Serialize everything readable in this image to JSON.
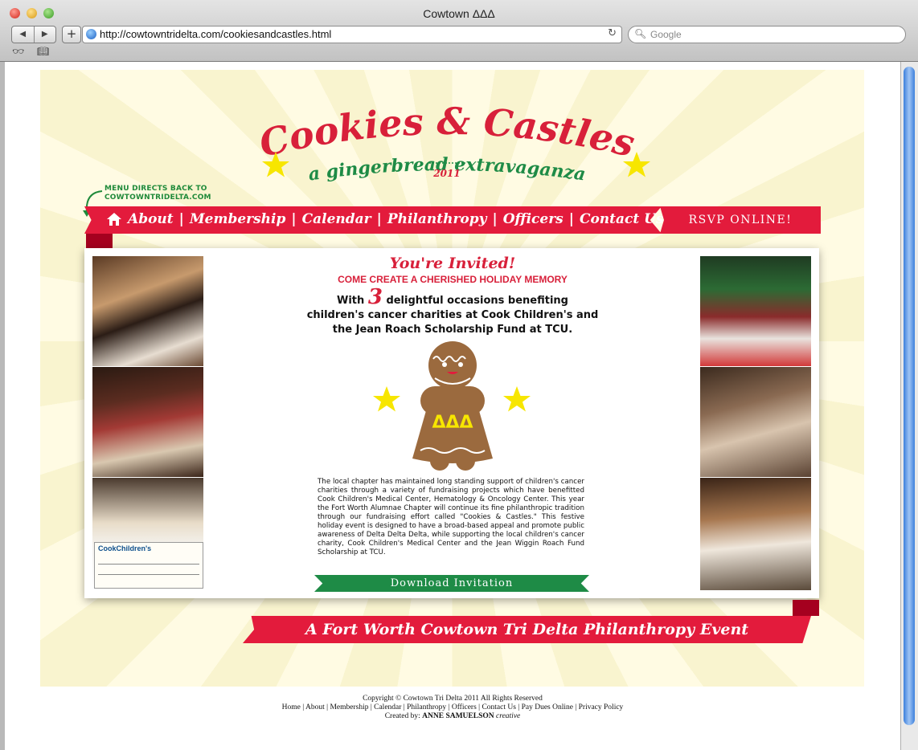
{
  "browser": {
    "window_title": "Cowtown ΔΔΔ",
    "url": "http://cowtowntridelta.com/cookiesandcastles.html",
    "search_placeholder": "Google"
  },
  "header": {
    "menu_note_line1": "MENU DIRECTS BACK TO",
    "menu_note_line2": "COWTOWNTRIDELTA.COM",
    "logo_line1": "Cookies & Castles",
    "logo_line2": "a gingerbread extravaganza",
    "logo_year": "2011"
  },
  "nav": {
    "items": [
      "About",
      "Membership",
      "Calendar",
      "Philanthropy",
      "Officers",
      "Contact Us"
    ],
    "rsvp": "RSVP ONLINE!"
  },
  "invite": {
    "title": "You're Invited!",
    "subtitle": "COME CREATE A CHERISHED HOLIDAY MEMORY",
    "body_prefix": "With",
    "number": "3",
    "body_line1": "delightful occasions benefiting",
    "body_line2": "children's cancer charities at Cook Children's and",
    "body_line3": "the Jean Roach Scholarship Fund at TCU.",
    "badge": "ΔΔΔ",
    "paragraph": "The local chapter has maintained long standing support of children's cancer charities through a variety of fundraising projects which have benefitted Cook Children's Medical Center, Hematology & Oncology Center. This year the Fort Worth Alumnae Chapter will continue its fine philanthropic tradition through our fundraising effort called \"Cookies & Castles.\" This festive holiday event is designed to have a broad-based appeal and promote public awareness of Delta Delta Delta, while supporting the local children's cancer charity, Cook Children's Medical Center and the Jean Wiggin Roach Fund Scholarship at TCU.",
    "download": "Download Invitation",
    "check_label": "CookChildren's"
  },
  "banner": "A Fort Worth Cowtown Tri Delta Philanthropy Event",
  "footer": {
    "copyright": "Copyright © Cowtown Tri Delta 2011 All Rights Reserved",
    "links": [
      "Home",
      "About",
      "Membership",
      "Calendar",
      "Philanthropy",
      "Officers",
      "Contact Us",
      "Pay Dues Online",
      "Privacy Policy"
    ],
    "credit_prefix": "Created by:",
    "credit_name": "ANNE SAMUELSON",
    "credit_suffix": "creative"
  },
  "colors": {
    "brand_red": "#e31b3c",
    "brand_green": "#1e8b46",
    "star_yellow": "#f7e600"
  }
}
